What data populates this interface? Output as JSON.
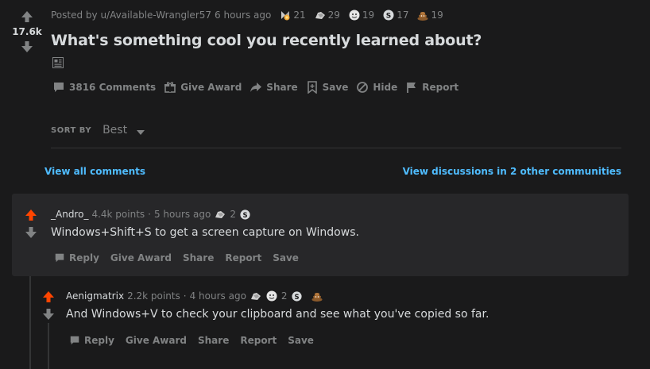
{
  "post": {
    "score": "17.6k",
    "posted_by": "Posted by u/Available-Wrangler57",
    "time": "6 hours ago",
    "awards": [
      {
        "icon": "silver-award-icon",
        "count": "21"
      },
      {
        "icon": "helpful-award-icon",
        "count": "29"
      },
      {
        "icon": "wholesome-award-icon",
        "count": "19"
      },
      {
        "icon": "coin-award-icon",
        "count": "17"
      },
      {
        "icon": "poop-award-icon",
        "count": "19"
      }
    ],
    "title": "What's something cool you recently learned about?",
    "actions": {
      "comments": "3816 Comments",
      "give_award": "Give Award",
      "share": "Share",
      "save": "Save",
      "hide": "Hide",
      "report": "Report"
    }
  },
  "sort": {
    "label": "SORT BY",
    "value": "Best"
  },
  "links": {
    "view_all": "View all comments",
    "view_discussions": "View discussions in 2 other communities"
  },
  "comments": [
    {
      "author": "_Andro_",
      "points": "4.4k points",
      "dot": "·",
      "time": "5 hours ago",
      "award_count": "2",
      "body": "Windows+Shift+S to get a screen capture on Windows.",
      "actions": {
        "reply": "Reply",
        "give_award": "Give Award",
        "share": "Share",
        "report": "Report",
        "save": "Save"
      }
    },
    {
      "author": "Aenigmatrix",
      "points": "2.2k points",
      "dot": "·",
      "time": "4 hours ago",
      "award_count": "2",
      "body": "And Windows+V to check your clipboard and see what you've copied so far.",
      "actions": {
        "reply": "Reply",
        "give_award": "Give Award",
        "share": "Share",
        "report": "Report",
        "save": "Save"
      }
    }
  ],
  "colors": {
    "background": "#1a1a1b",
    "comment_bg": "#272729",
    "upvote_active": "#ff4500",
    "link": "#4fbcff",
    "muted": "#818384"
  }
}
